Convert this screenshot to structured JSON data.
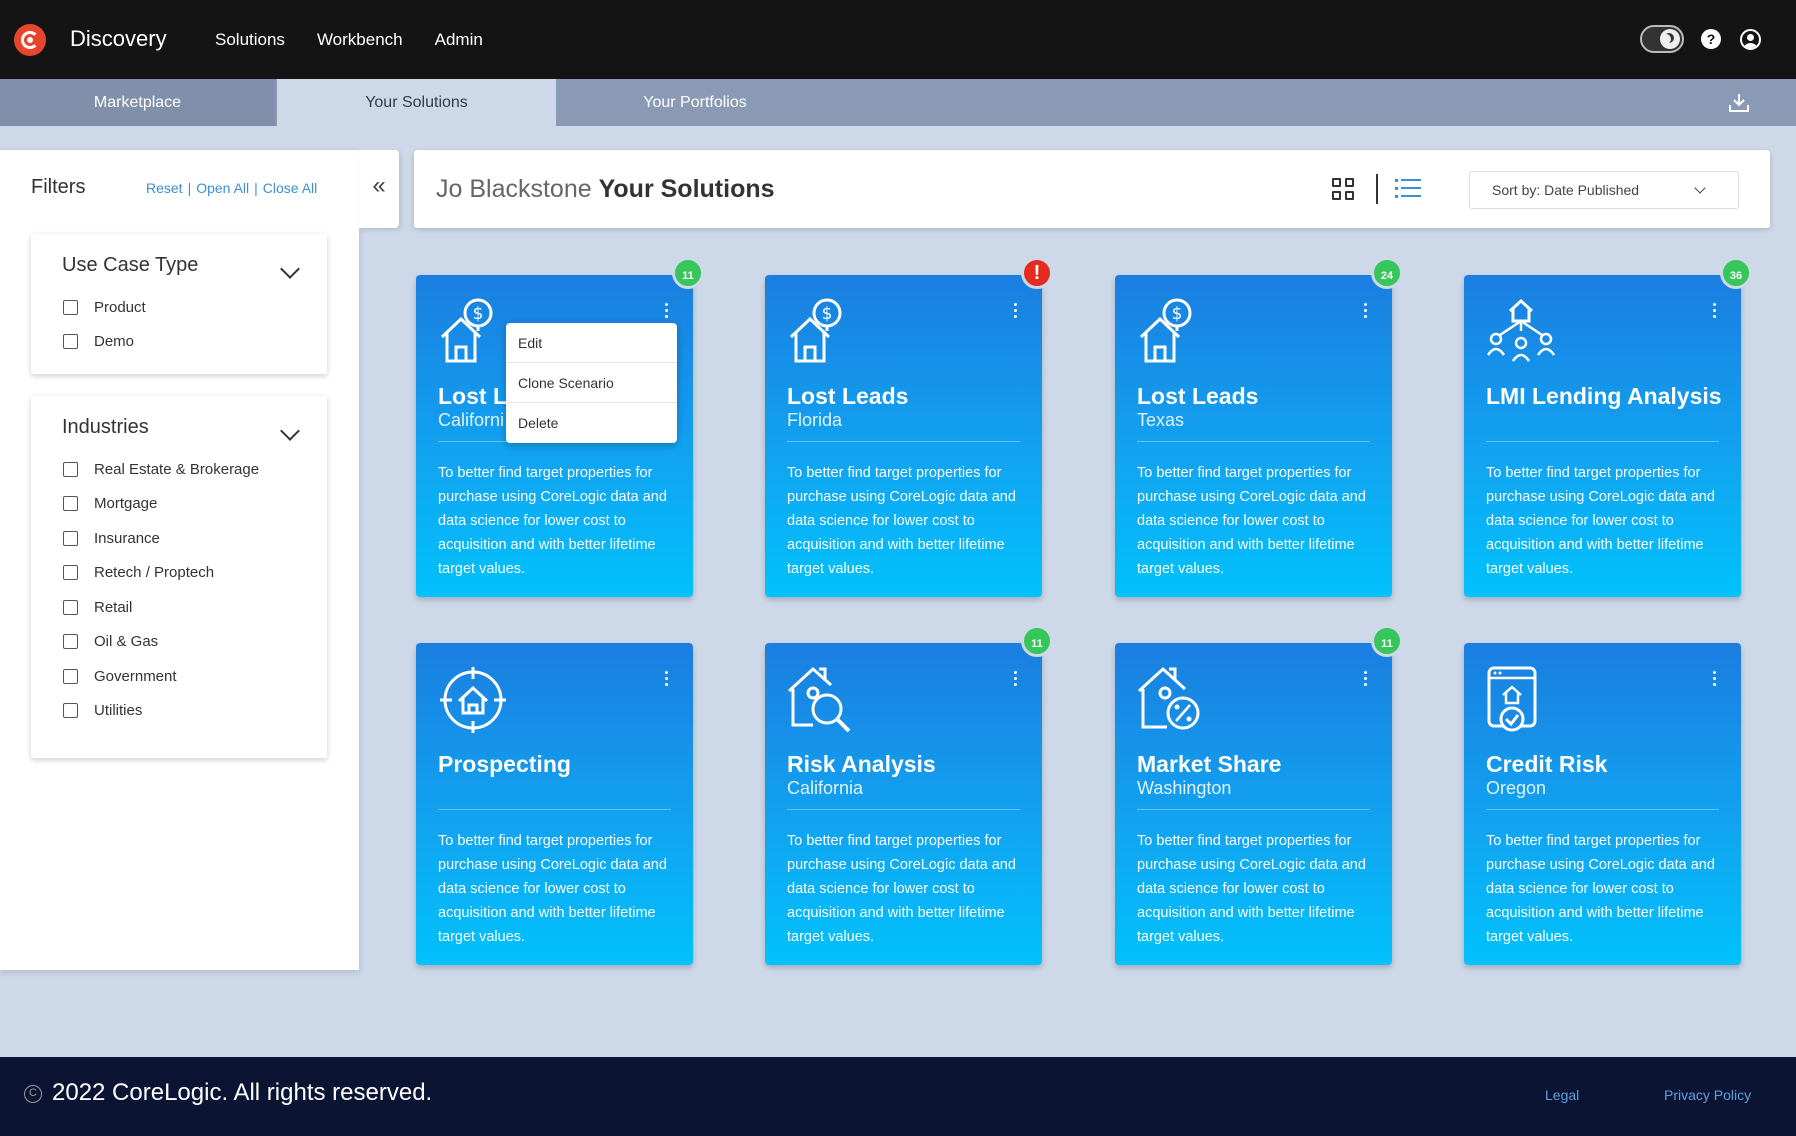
{
  "app": {
    "brand": "Discovery",
    "nav": [
      "Solutions",
      "Workbench",
      "Admin"
    ]
  },
  "tabs": [
    "Marketplace",
    "Your Solutions",
    "Your Portfolios"
  ],
  "filters": {
    "title": "Filters",
    "links": [
      "Reset",
      "Open All",
      "Close All"
    ],
    "groups": [
      {
        "title": "Use Case Type",
        "options": [
          "Product",
          "Demo"
        ]
      },
      {
        "title": "Industries",
        "options": [
          "Real Estate & Brokerage",
          "Mortgage",
          "Insurance",
          "Retech / Proptech",
          "Retail",
          "Oil & Gas",
          "Government",
          "Utilities"
        ]
      }
    ]
  },
  "header": {
    "user_name": "Jo Blackstone",
    "title": "Your Solutions",
    "sort_label": "Sort by: Date Published"
  },
  "cards": [
    {
      "title": "Lost Leads",
      "title_visible": "Lost Le",
      "subtitle": "California",
      "subtitle_visible": "Californi",
      "icon": "house-dollar-icon",
      "badge": "11",
      "badge_type": "count"
    },
    {
      "title": "Lost Leads",
      "subtitle": "Florida",
      "icon": "house-dollar-icon",
      "badge": "!",
      "badge_type": "alert"
    },
    {
      "title": "Lost Leads",
      "subtitle": "Texas",
      "icon": "house-dollar-icon",
      "badge": "24",
      "badge_type": "count"
    },
    {
      "title": "LMI Lending Analysis",
      "subtitle": "",
      "icon": "house-people-icon",
      "badge": "36",
      "badge_type": "count"
    },
    {
      "title": "Prospecting",
      "subtitle": "",
      "icon": "house-target-icon",
      "badge": "",
      "badge_type": "none"
    },
    {
      "title": "Risk Analysis",
      "subtitle": "California",
      "icon": "house-search-icon",
      "badge": "11",
      "badge_type": "count"
    },
    {
      "title": "Market Share",
      "subtitle": "Washington",
      "icon": "house-percent-icon",
      "badge": "11",
      "badge_type": "count"
    },
    {
      "title": "Credit Risk",
      "subtitle": "Oregon",
      "icon": "document-check-icon",
      "badge": "",
      "badge_type": "none"
    }
  ],
  "card_description": "To better find target properties for purchase  using CoreLogic data and data science for lower cost to acquisition and with better lifetime target values.",
  "context_menu": [
    "Edit",
    "Clone Scenario",
    "Delete"
  ],
  "footer": {
    "copyright": "2022 CoreLogic. All rights reserved.",
    "links": [
      "Legal",
      "Privacy Policy"
    ]
  }
}
